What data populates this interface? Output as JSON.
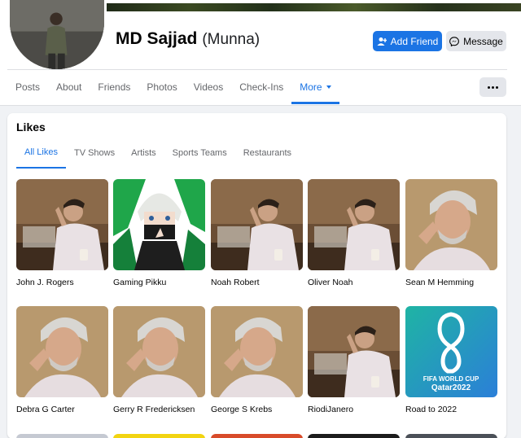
{
  "profile": {
    "name": "MD Sajjad",
    "alt_name": "(Munna)",
    "add_friend_label": "Add Friend",
    "message_label": "Message"
  },
  "nav": {
    "tabs": [
      "Posts",
      "About",
      "Friends",
      "Photos",
      "Videos",
      "Check-Ins",
      "More"
    ],
    "active_tab": "More"
  },
  "likes": {
    "title": "Likes",
    "subtabs": [
      "All Likes",
      "TV Shows",
      "Artists",
      "Sports Teams",
      "Restaurants"
    ],
    "active_subtab": "All Likes",
    "items": [
      {
        "name": "John J. Rogers",
        "image": "man-at-desk-photo"
      },
      {
        "name": "Gaming Pikku",
        "image": "anime-avatar-green"
      },
      {
        "name": "Noah Robert",
        "image": "man-at-desk-photo"
      },
      {
        "name": "Oliver Noah",
        "image": "man-at-desk-photo"
      },
      {
        "name": "Sean M Hemming",
        "image": "grey-hair-man-photo"
      },
      {
        "name": "Debra G Carter",
        "image": "grey-hair-man-photo"
      },
      {
        "name": "Gerry R Fredericksen",
        "image": "grey-hair-man-photo"
      },
      {
        "name": "George S Krebs",
        "image": "grey-hair-man-photo"
      },
      {
        "name": "RiodiJanero",
        "image": "man-at-desk-photo"
      },
      {
        "name": "Road to 2022",
        "image": "fifa-world-cup-logo"
      }
    ],
    "fifa_logo_text_1": "FIFA WORLD CUP",
    "fifa_logo_text_2": "Qatar2022"
  },
  "colors": {
    "accent": "#1b74e4",
    "button_grey": "#e4e6eb",
    "background": "#f0f2f5"
  }
}
